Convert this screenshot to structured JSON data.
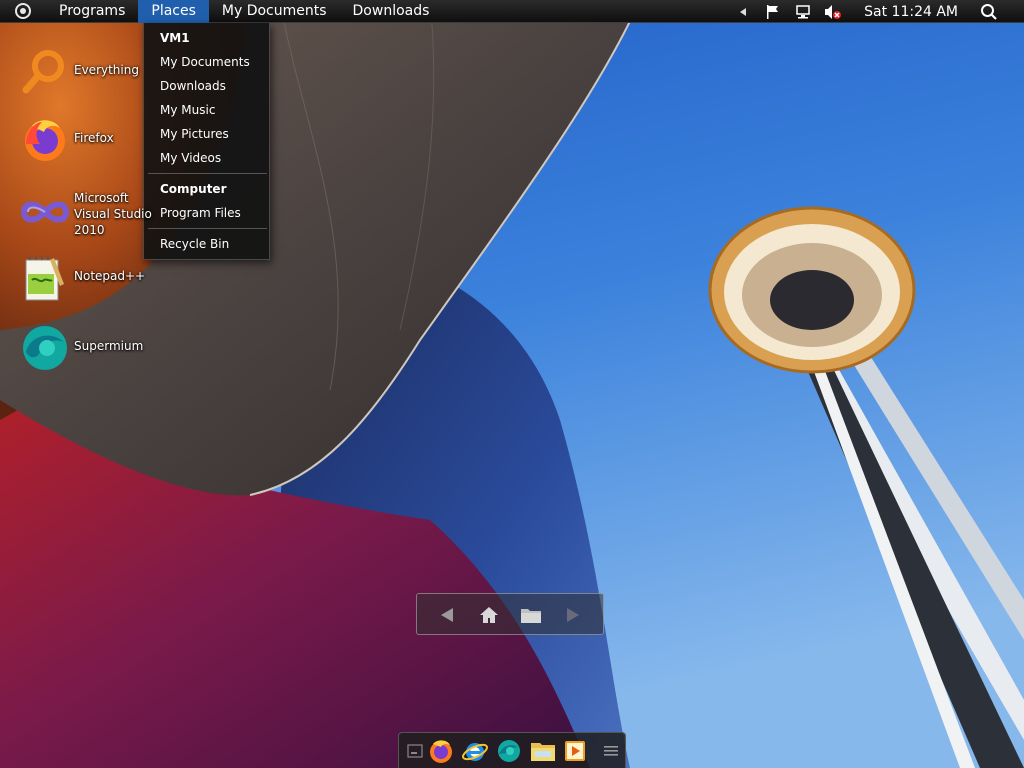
{
  "menubar": {
    "start_icon": "start-orb-icon",
    "items": [
      {
        "label": "Programs"
      },
      {
        "label": "Places"
      },
      {
        "label": "My Documents"
      },
      {
        "label": "Downloads"
      }
    ],
    "active_item": "Places",
    "tray": {
      "icons": [
        "expand-tray-arrow-icon",
        "flag-icon",
        "network-icon",
        "volume-muted-icon"
      ],
      "clock": "Sat 11:24 AM",
      "search_icon": "search-icon"
    }
  },
  "places_menu": {
    "groups": [
      {
        "header": "VM1",
        "items": [
          "My Documents",
          "Downloads",
          "My Music",
          "My Pictures",
          "My Videos"
        ]
      },
      {
        "header": "Computer",
        "items": [
          "Program Files"
        ]
      },
      {
        "header": "",
        "items": [
          "Recycle Bin"
        ]
      }
    ]
  },
  "desktop_icons": [
    {
      "label": "Everything",
      "icon": "everything-search-icon"
    },
    {
      "label": "Firefox",
      "icon": "firefox-icon"
    },
    {
      "label": "Microsoft Visual Studio 2010",
      "icon": "visual-studio-icon"
    },
    {
      "label": "Notepad++",
      "icon": "notepadpp-icon"
    },
    {
      "label": "Supermium",
      "icon": "supermium-icon"
    }
  ],
  "nav_panel": {
    "buttons": [
      "back-arrow-icon",
      "home-icon",
      "folder-icon",
      "forward-arrow-icon"
    ]
  },
  "dock": {
    "items": [
      "show-desktop-icon",
      "firefox-icon",
      "internet-explorer-icon",
      "supermium-icon",
      "file-explorer-icon",
      "media-player-icon",
      "dock-menu-icon"
    ]
  },
  "colors": {
    "menubar_bg": "#161616",
    "menu_active": "#1f5fad",
    "sky": "#2f6fd0",
    "building_orange": "#c8601c"
  }
}
